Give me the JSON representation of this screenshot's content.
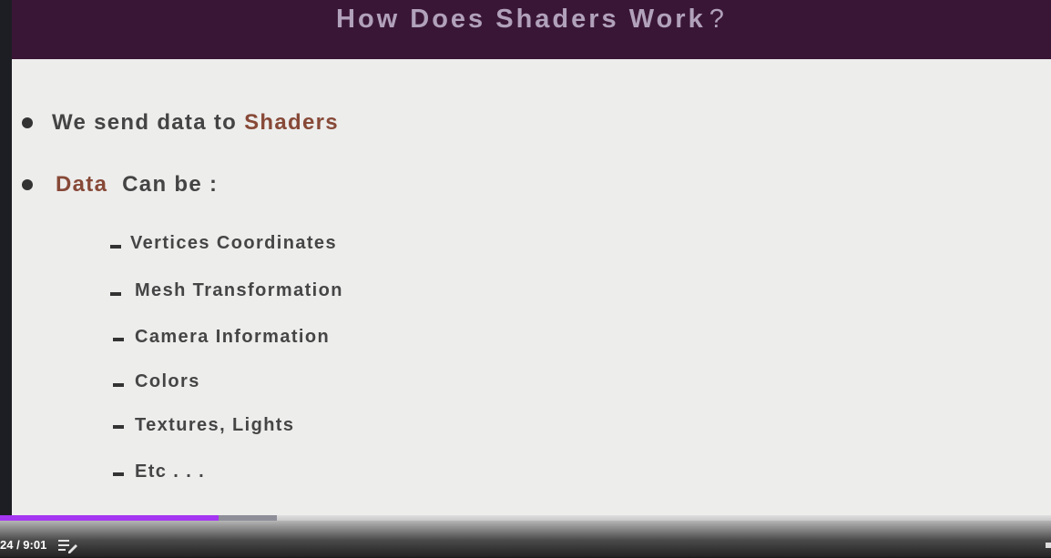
{
  "slide": {
    "title": "How Does Shaders Work",
    "title_glyph": "?",
    "bullets": [
      {
        "text": "We send data to",
        "accent": "Shaders"
      },
      {
        "accent": "Data",
        "text": "Can be :"
      }
    ],
    "sub_items": [
      "Vertices Coordinates",
      "Mesh Transformation",
      "Camera Information",
      "Colors",
      "Textures, Lights",
      "Etc . . ."
    ]
  },
  "player": {
    "time": "24 / 9:01",
    "progress_played_percent": 20.8,
    "progress_buffered_percent": 26.3,
    "accent_color": "#a435f0",
    "transcript_icon": "transcript-list-icon"
  },
  "colors": {
    "title_bar": "#3a1636",
    "title_text": "#b1a1bb",
    "accent_text": "#874937",
    "body_text": "#444444",
    "slide_bg": "#ededec"
  }
}
